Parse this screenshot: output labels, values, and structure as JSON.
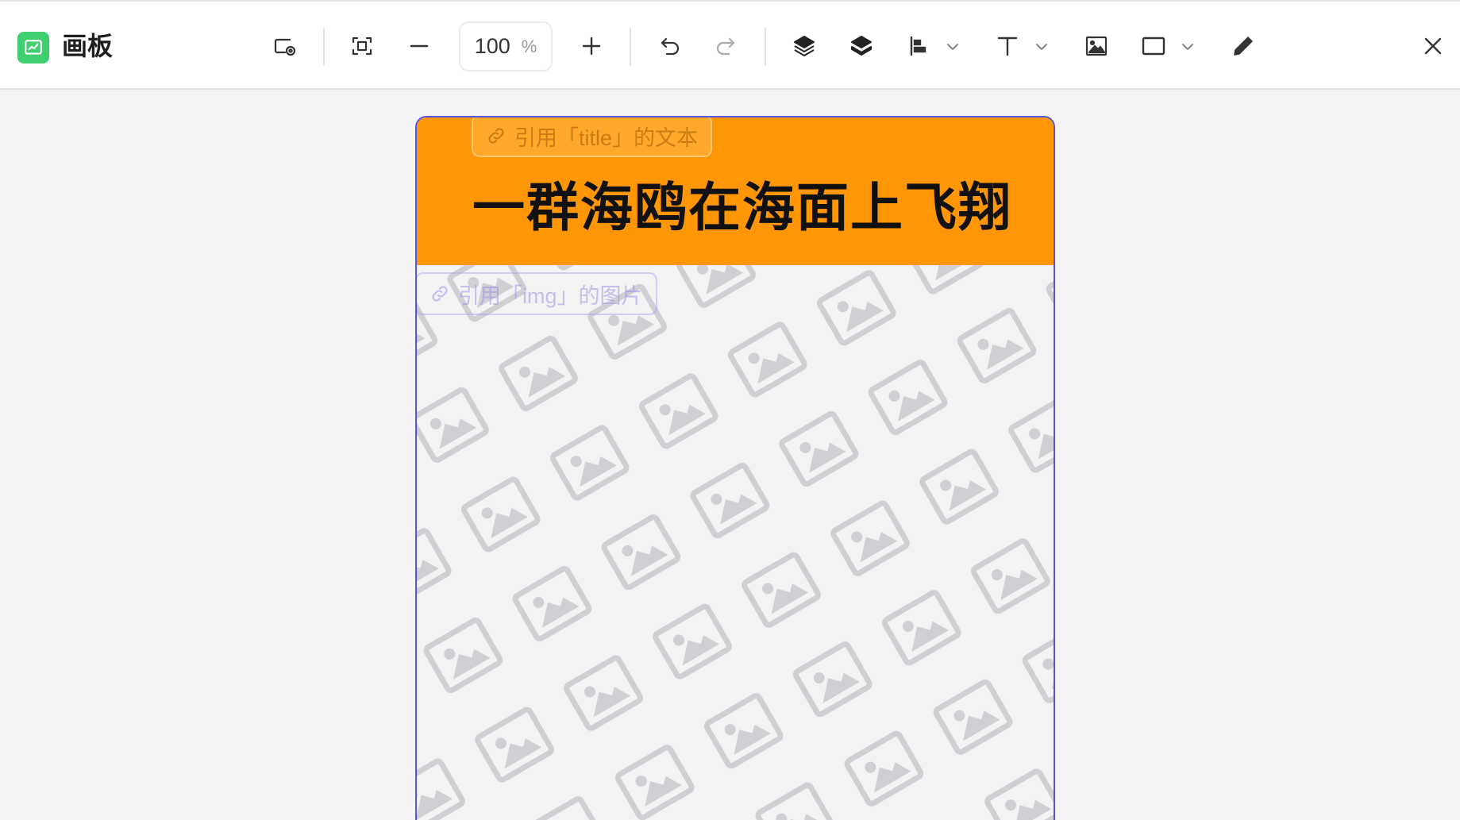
{
  "app": {
    "title": "画板",
    "accent": "#3fcf6e"
  },
  "toolbar": {
    "zoom_value": "100",
    "zoom_unit": "%",
    "icons": [
      "canvas-settings-icon",
      "fit-screen-icon",
      "zoom-out-icon",
      "zoom-in-icon",
      "undo-icon",
      "redo-icon",
      "bring-forward-icon",
      "layers-icon",
      "align-icon",
      "text-tool-icon",
      "image-tool-icon",
      "shape-tool-icon",
      "pen-tool-icon",
      "close-icon"
    ]
  },
  "board": {
    "header_color": "#ff9605",
    "border_color": "#5a53e0",
    "title": "一群海鸥在海面上飞翔",
    "title_ref": "引用「title」的文本",
    "img_ref": "引用「img」的图片"
  }
}
